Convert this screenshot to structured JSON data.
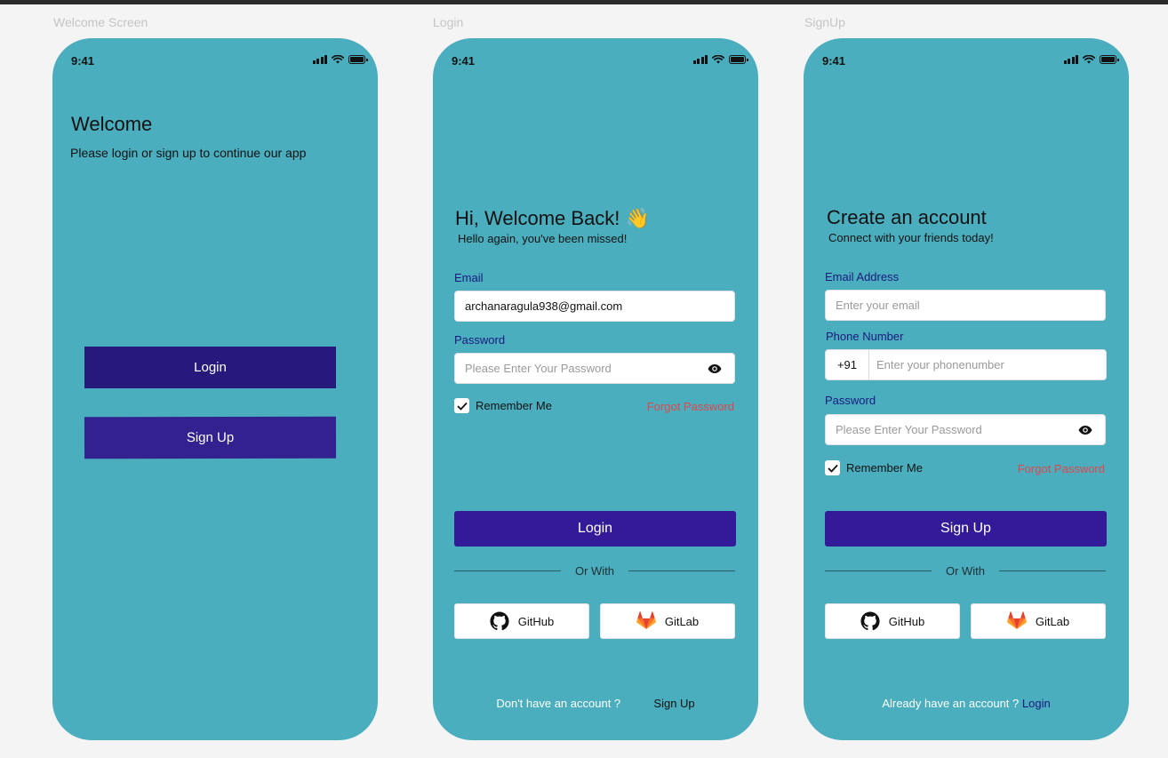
{
  "frames": {
    "welcome_label": "Welcome Screen",
    "login_label": "Login",
    "signup_label": "SignUp"
  },
  "status": {
    "time": "9:41"
  },
  "welcome": {
    "title": "Welcome",
    "subtitle": "Please login or sign up to continue our app",
    "login_button": "Login",
    "signup_button": "Sign Up"
  },
  "login": {
    "title": "Hi, Welcome Back! 👋",
    "subtitle": "Hello again, you've been missed!",
    "email_label": "Email",
    "email_value": "archanaragula938@gmail.com",
    "password_label": "Password",
    "password_placeholder": "Please Enter Your Password",
    "remember_label": "Remember Me",
    "forgot_label": "Forgot Password",
    "login_button": "Login",
    "or_with": "Or With",
    "github": "GitHub",
    "gitlab": "GitLab",
    "footer_text": "Don't have an account ?",
    "footer_link": "Sign Up"
  },
  "signup": {
    "title": "Create an account",
    "subtitle": "Connect with your friends today!",
    "email_label": "Email Address",
    "email_placeholder": "Enter your email",
    "phone_label": "Phone Number",
    "country_code": "+91",
    "phone_placeholder": "Enter your phonenumber",
    "password_label": "Password",
    "password_placeholder": "Please Enter Your Password",
    "remember_label": "Remember Me",
    "forgot_label": "Forgot Password",
    "signup_button": "Sign Up",
    "or_with": "Or With",
    "github": "GitHub",
    "gitlab": "GitLab",
    "footer_text": "Already have an account ?",
    "footer_link": "Login"
  },
  "colors": {
    "background": "#f4f4f4",
    "phone_bg": "#4aaebe",
    "primary": "#331a99",
    "forgot": "#e0474c",
    "label": "#1a1a7e"
  },
  "icons": [
    "signal-icon",
    "wifi-icon",
    "battery-icon",
    "eye-icon",
    "check-icon",
    "github-icon",
    "gitlab-icon"
  ]
}
